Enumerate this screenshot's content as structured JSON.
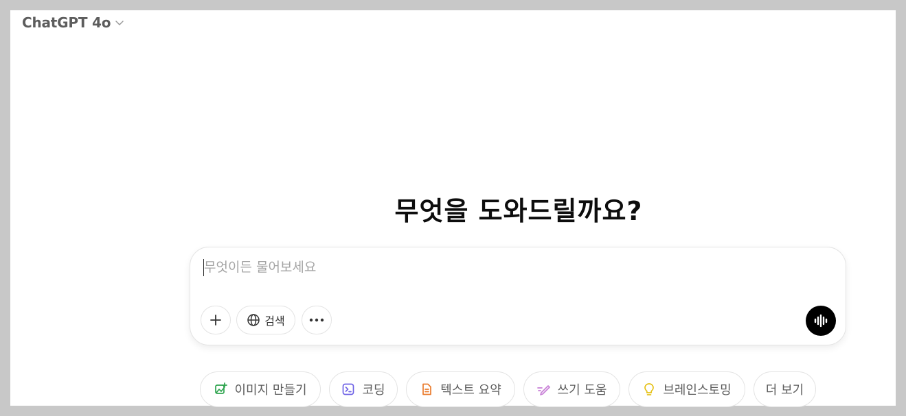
{
  "header": {
    "model_name": "ChatGPT 4o",
    "chevron_icon": "chevron-down-icon"
  },
  "main": {
    "headline": "무엇을 도와드릴까요?"
  },
  "composer": {
    "placeholder": "무엇이든 물어보세요",
    "value": "",
    "tools": {
      "add_icon": "plus-icon",
      "search_label": "검색",
      "search_icon": "globe-icon",
      "more_icon": "more-horizontal-icon",
      "voice_icon": "voice-waveform-icon"
    }
  },
  "suggestions": [
    {
      "label": "이미지 만들기",
      "icon": "image-create-icon",
      "color": "#2ea44f"
    },
    {
      "label": "코딩",
      "icon": "terminal-icon",
      "color": "#6f63e6"
    },
    {
      "label": "텍스트 요약",
      "icon": "document-icon",
      "color": "#ea7b2c"
    },
    {
      "label": "쓰기 도움",
      "icon": "pen-icon",
      "color": "#c77ed6"
    },
    {
      "label": "브레인스토밍",
      "icon": "lightbulb-icon",
      "color": "#e6c21a"
    },
    {
      "label": "더 보기",
      "icon": "",
      "color": ""
    }
  ]
}
